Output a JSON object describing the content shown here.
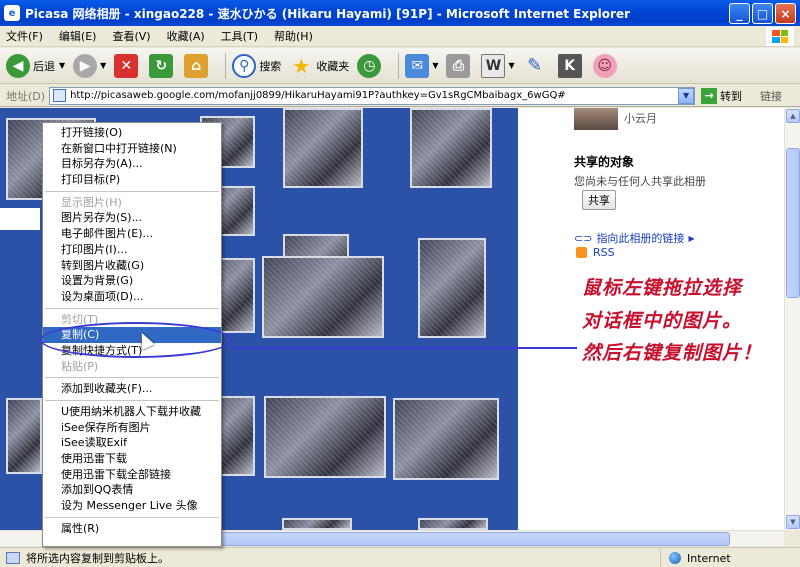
{
  "window": {
    "title": "Picasa 网络相册 - xingao228 - 速水ひかる (Hikaru Hayami) [91P] - Microsoft Internet Explorer",
    "app_icon": "e",
    "controls": {
      "minimize": "_",
      "maximize": "□",
      "close": "×"
    }
  },
  "menubar": [
    "文件(F)",
    "编辑(E)",
    "查看(V)",
    "收藏(A)",
    "工具(T)",
    "帮助(H)"
  ],
  "toolbar": {
    "back": "后退",
    "search": "搜索",
    "favorites": "收藏夹"
  },
  "addressbar": {
    "label": "地址(D)",
    "url": "http://picasaweb.google.com/mofanjj0899/HikaruHayami91P?authkey=Gv1sRgCMbaibagx_6wGQ#",
    "go": "转到",
    "links": "链接"
  },
  "sidebar": {
    "owner_suffix": "小云月",
    "share_title": "共享的对象",
    "share_text": "您尚未与任何人共享此相册",
    "share_button": "共享",
    "album_link": "指向此相册的链接",
    "rss": "RSS"
  },
  "context_menu": {
    "group1": [
      "打开链接(O)",
      "在新窗口中打开链接(N)",
      "目标另存为(A)...",
      "打印目标(P)"
    ],
    "group2": [
      "显示图片(H)",
      "图片另存为(S)...",
      "电子邮件图片(E)...",
      "打印图片(I)...",
      "转到图片收藏(G)",
      "设置为背景(G)",
      "设为桌面项(D)..."
    ],
    "group3_cut": "剪切(T)",
    "group3_copy": "复制(C)",
    "group3_copy_shortcut": "复制快捷方式(T)",
    "group3_paste": "粘贴(P)",
    "group4": [
      "添加到收藏夹(F)..."
    ],
    "group5": [
      "U使用纳米机器人下载并收藏",
      "iSee保存所有图片",
      "iSee读取Exif",
      "使用迅雷下载",
      "使用迅雷下载全部链接",
      "添加到QQ表情",
      "设为 Messenger Live 头像"
    ],
    "group6": [
      "属性(R)"
    ]
  },
  "annotation": {
    "line1": "鼠标左键拖拉选择",
    "line2": "对话框中的图片。",
    "line3": "然后右键复制图片！"
  },
  "statusbar": {
    "text": "将所选内容复制到剪贴板上。",
    "zone": "Internet"
  }
}
